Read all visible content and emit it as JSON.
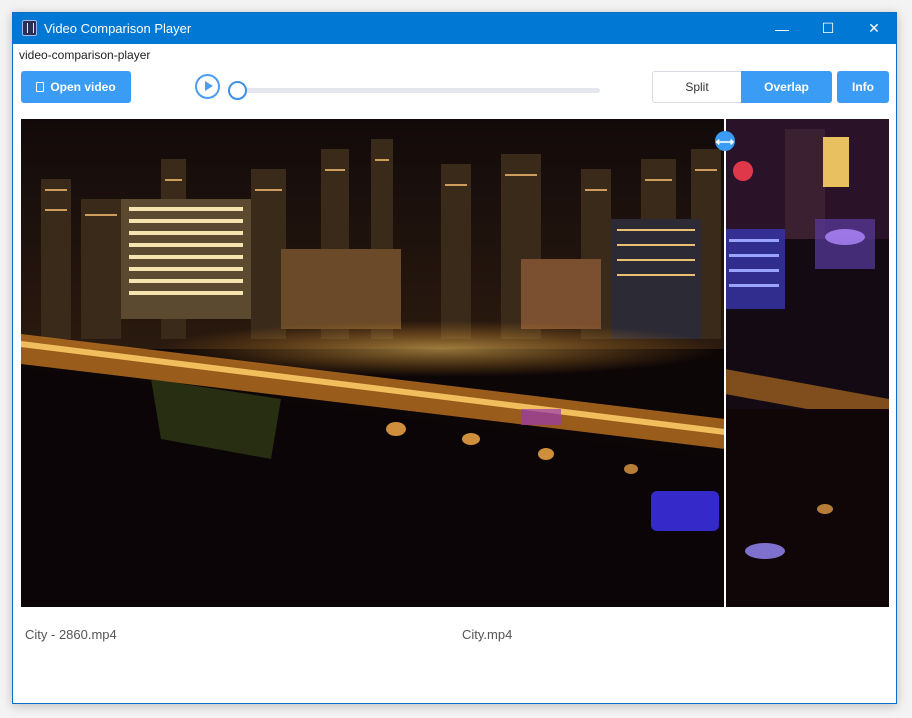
{
  "window": {
    "title": "Video Comparison Player"
  },
  "titlebar_controls": {
    "minimize": "—",
    "maximize": "☐",
    "close": "✕"
  },
  "app": {
    "subtitle": "video-comparison-player"
  },
  "toolbar": {
    "open_label": "Open video",
    "modes": {
      "split": "Split",
      "overlap": "Overlap",
      "active": "Overlap"
    },
    "info_label": "Info",
    "progress": 0
  },
  "compare": {
    "handle_glyph": "⟷"
  },
  "videos": {
    "left": "City - 2860.mp4",
    "right": "City.mp4"
  },
  "colors": {
    "accent": "#3b9cf6",
    "titlebar": "#0078d4"
  }
}
